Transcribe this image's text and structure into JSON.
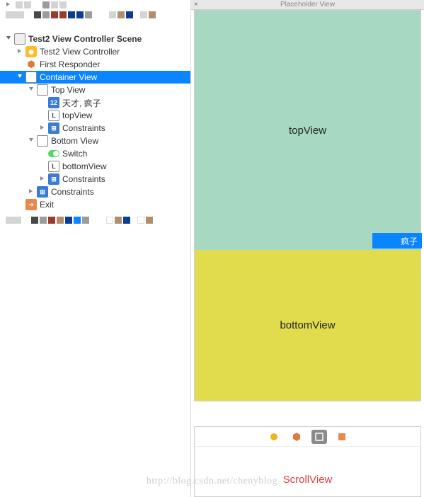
{
  "header": {
    "placeholder_title": "Placeholder View"
  },
  "tree": {
    "scene_name": "Test2 View Controller Scene",
    "items": [
      {
        "label": "Test2 View Controller"
      },
      {
        "label": "First Responder"
      },
      {
        "label": "Container View"
      },
      {
        "label": "Top View"
      },
      {
        "label": "天才, 疯子"
      },
      {
        "label": "topView"
      },
      {
        "label": "Constraints"
      },
      {
        "label": "Bottom View"
      },
      {
        "label": "Switch"
      },
      {
        "label": "bottomView"
      },
      {
        "label": "Constraints"
      },
      {
        "label": "Constraints"
      },
      {
        "label": "Exit"
      }
    ]
  },
  "canvas": {
    "top_label": "topView",
    "bottom_label": "bottomView",
    "button_label": "疯子",
    "scroll_label": "ScrollView"
  },
  "colors": {
    "top_bg": "#a7d9c2",
    "bottom_bg": "#e0dc4e",
    "selection_bg": "#0a84ff",
    "accent_red": "#e73c3c"
  },
  "watermark": "http://blog.csdn.net/chenyblog"
}
